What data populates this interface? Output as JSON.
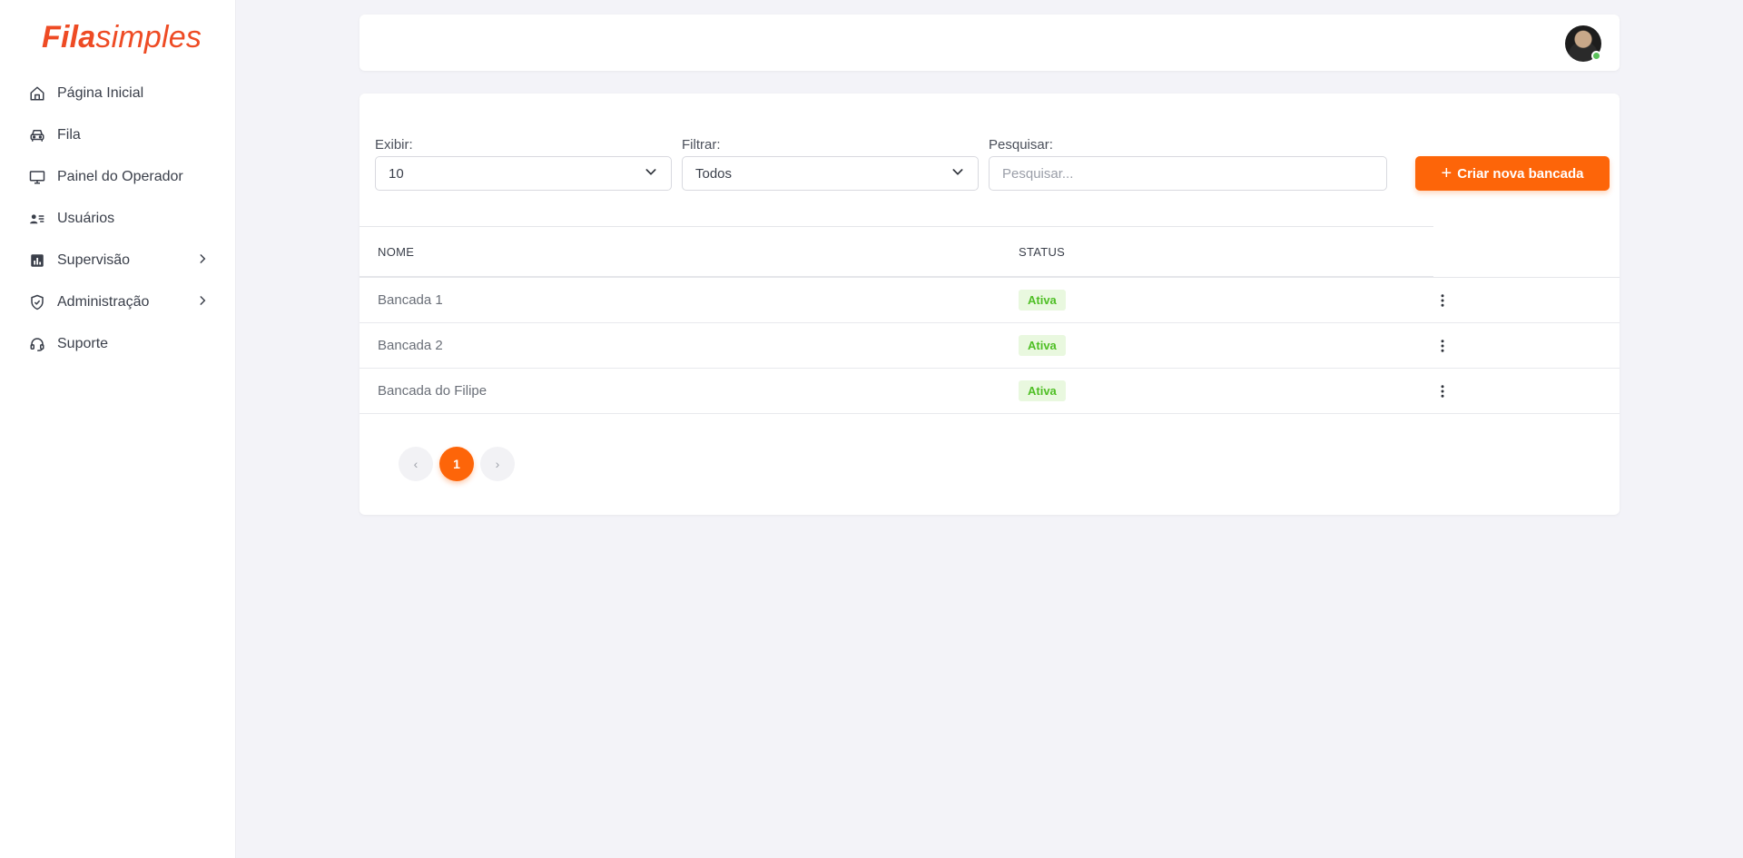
{
  "brand": {
    "bold": "Fila",
    "light": "simples",
    "color": "#ee4b24"
  },
  "sidebar": {
    "items": [
      {
        "label": "Página Inicial",
        "icon": "home-icon",
        "has_children": false
      },
      {
        "label": "Fila",
        "icon": "car-icon",
        "has_children": false
      },
      {
        "label": "Painel do Operador",
        "icon": "monitor-icon",
        "has_children": false
      },
      {
        "label": "Usuários",
        "icon": "user-list-icon",
        "has_children": false
      },
      {
        "label": "Supervisão",
        "icon": "bar-chart-icon",
        "has_children": true
      },
      {
        "label": "Administração",
        "icon": "shield-check-icon",
        "has_children": true
      },
      {
        "label": "Suporte",
        "icon": "headset-icon",
        "has_children": false
      }
    ]
  },
  "header": {
    "avatar_status": "online"
  },
  "filters": {
    "show_label": "Exibir:",
    "show_value": "10",
    "filter_label": "Filtrar:",
    "filter_value": "Todos",
    "search_label": "Pesquisar:",
    "search_placeholder": "Pesquisar...",
    "create_button": "Criar nova bancada"
  },
  "table": {
    "columns": [
      "NOME",
      "STATUS"
    ],
    "rows": [
      {
        "name": "Bancada 1",
        "status": "Ativa"
      },
      {
        "name": "Bancada 2",
        "status": "Ativa"
      },
      {
        "name": "Bancada do Filipe",
        "status": "Ativa"
      }
    ]
  },
  "pagination": {
    "prev": "‹",
    "current": "1",
    "next": "›"
  },
  "colors": {
    "accent": "#fd6509",
    "badge_bg": "#e9f8df",
    "badge_text": "#4fbf25"
  }
}
